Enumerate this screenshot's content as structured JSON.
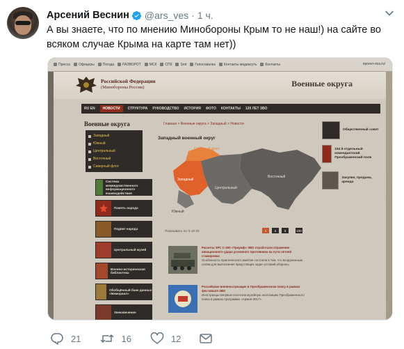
{
  "tweet": {
    "author_name": "Арсений Веснин",
    "handle": "@ars_ves",
    "separator": "·",
    "time": "1 ч.",
    "text": "А вы знаете, что по мнению Минобороны Крым то не наш!) на сайте во всяком случае Крыма на карте там нет))",
    "replies": "21",
    "retweets": "16",
    "likes": "12"
  },
  "photo": {
    "bookmarks": [
      "Пресса",
      "Офицеры",
      "Погода",
      "РАЗВОРОТ",
      "МСК",
      "СПб",
      "Smt",
      "Голосовалка",
      "Контакты медиаcуть",
      "Контакты"
    ],
    "url": "проект-поз.ru/",
    "site": {
      "org_line1": "Российской Федерации",
      "org_line2": "(Минобороны России)",
      "title": "Военные округа",
      "menu": [
        "RU EN",
        "НОВОСТИ",
        "СТРУКТУРА",
        "РУКОВОДСТВО",
        "ИСТОРИЯ",
        "ФОТО",
        "КОНТАКТЫ",
        "120 ЛЕТ ЗВО"
      ],
      "left_title": "Военные округа",
      "left_list": [
        "Западный",
        "Южный",
        "Центральный",
        "Восточный",
        "Северный флот"
      ],
      "side_items": [
        "Система межведомственного информационного взаимодействия",
        "Память народа",
        "Подвиг народа",
        "Центральный музей",
        "Военно-историческая библиотека",
        "Обобщённый банк данных «Мемориал»",
        "Увековечение"
      ],
      "breadcrumbs": "Главная > Военные округа > Западный > Новости",
      "map_title": "Западный военный округ",
      "map_labels": [
        "Северный флот",
        "Западный",
        "Южный",
        "Центральный",
        "Восточный"
      ],
      "pagination_label": "Показывать по:  5  10  20",
      "pages": [
        "1",
        "2",
        "3",
        "100"
      ],
      "news": [
        {
          "title": "Расчеты ЗРС С-400 «Триумф» ЗВО отработали отражение авиационного удара условного противника на пути летней стажировки",
          "body": "Особенность практического занятия состояла в том, что вооруженным силам для выполнения предстоящих задач условий обороны."
        },
        {
          "title": "Российские военнослужащие в Преображенском полку в рамках фестиваля ЗВО",
          "body": "Иностранцы впервые посетили музейную экспозицию Преображенского полка в рамках программы «Армия-2017»."
        }
      ],
      "right_items": [
        "Общественный совет",
        "154 й отдельный комендантский Преображенский полк",
        "Закупки, продажа, аренда"
      ]
    }
  }
}
